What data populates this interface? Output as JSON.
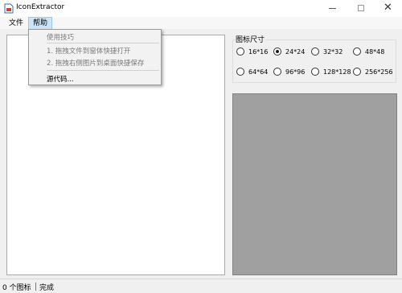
{
  "window": {
    "title": "IconExtractor",
    "close_glyph": "✕"
  },
  "menubar": {
    "file": "文件",
    "help": "帮助"
  },
  "help_menu": {
    "items": [
      {
        "label": "使用技巧",
        "enabled": false
      },
      {
        "label": "1. 拖拽文件到窗体快捷打开",
        "enabled": false
      },
      {
        "label": "2. 拖拽右侧图片到桌面快捷保存",
        "enabled": false
      },
      {
        "label": "源代码...",
        "enabled": true
      }
    ]
  },
  "icon_size_group": {
    "label": "图标尺寸",
    "options": [
      "16*16",
      "24*24",
      "32*32",
      "48*48",
      "64*64",
      "96*96",
      "128*128",
      "256*256"
    ],
    "selected": "24*24"
  },
  "statusbar": {
    "count": "0 个图标",
    "message": "完成"
  }
}
